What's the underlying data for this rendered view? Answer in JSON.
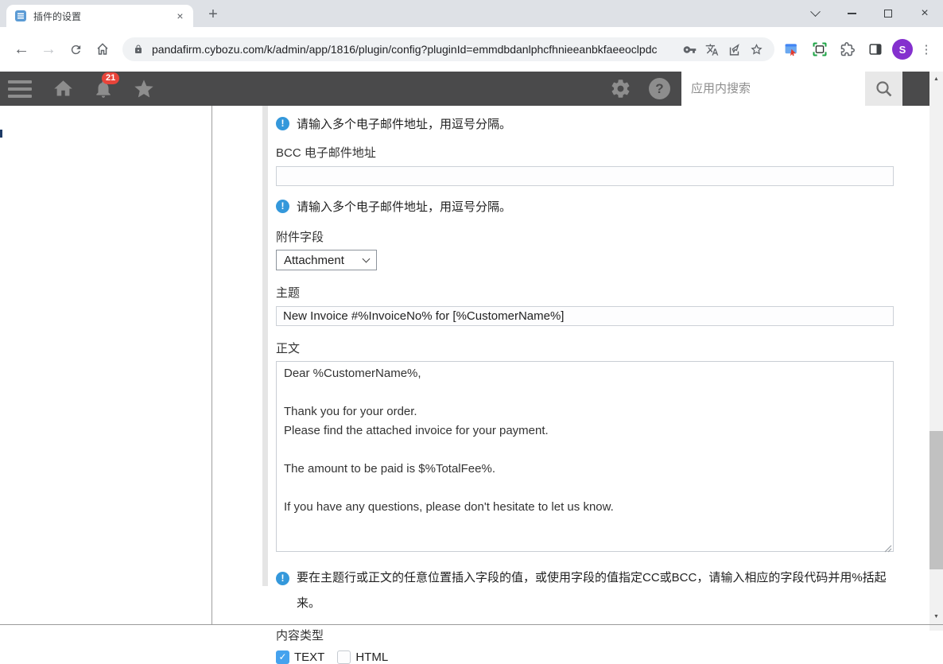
{
  "browser": {
    "tab_title": "插件的设置",
    "url": "pandafirm.cybozu.com/k/admin/app/1816/plugin/config?pluginId=emmdbdanlphcfhnieeanbkfaeeoclpdc",
    "profile_initial": "S"
  },
  "app_header": {
    "notification_count": "21",
    "search_placeholder": "应用内搜索"
  },
  "form": {
    "info_email": "请输入多个电子邮件地址，用逗号分隔。",
    "bcc_label": "BCC 电子邮件地址",
    "bcc_value": "",
    "attachment_label": "附件字段",
    "attachment_value": "Attachment",
    "subject_label": "主题",
    "subject_value": "New Invoice #%InvoiceNo% for [%CustomerName%]",
    "body_label": "正文",
    "body_value": "Dear %CustomerName%,\n\nThank you for your order.\nPlease find the attached invoice for your payment.\n\nThe amount to be paid is $%TotalFee%.\n\nIf you have any questions, please don't hesitate to let us know.",
    "info_fieldcode": "要在主题行或正文的任意位置插入字段的值，或使用字段的值指定CC或BCC，请输入相应的字段代码并用%括起来。",
    "content_type_label": "内容类型",
    "checkbox_text_label": "TEXT",
    "checkbox_html_label": "HTML"
  },
  "icons": {
    "tab_close": "×",
    "new_tab": "+",
    "window_close": "×",
    "back": "←",
    "forward": "→",
    "menu_dots": "⋮",
    "help": "?",
    "info": "!",
    "check": "✓",
    "scroll_up": "▲",
    "scroll_down": "▼"
  },
  "colors": {
    "info_blue": "#3498db",
    "checkbox_blue": "#45a2ee",
    "badge_red": "#e8443a",
    "header_bg": "#4a4a4b",
    "avatar_purple": "#8430ce",
    "titlebar_bg": "#dee1e6"
  }
}
